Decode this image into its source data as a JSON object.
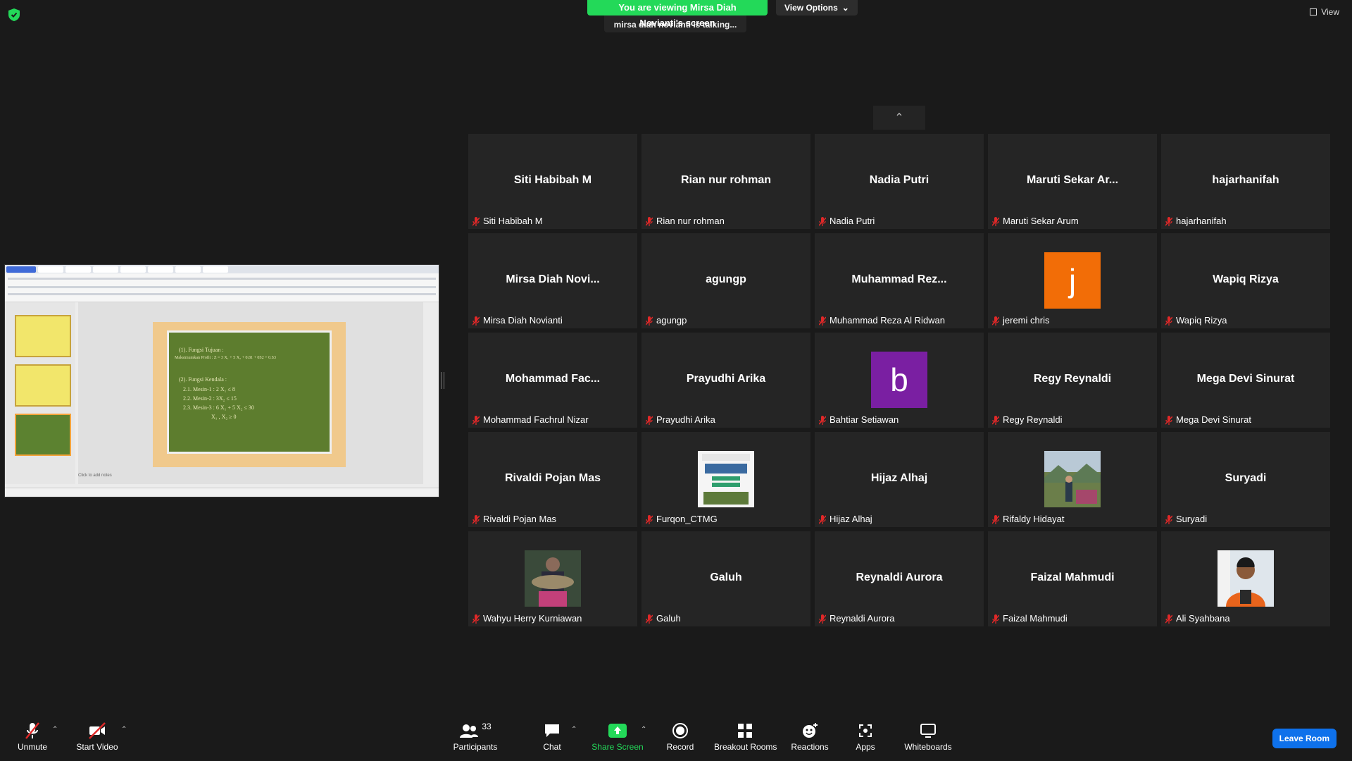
{
  "banner": {
    "viewing": "You are viewing Mirsa Diah Novianti's screen",
    "view_options": "View Options"
  },
  "talking": "mirsa diah novianti is talking...",
  "view_label": "View",
  "shared_slide": {
    "lines": [
      "(1). Fungsi Tujuan :",
      "Maksimumkan Profit : Z = 3 X₁ + 5 X₂ + 0.81 + 0S2 + 0.S3",
      "(2). Fungsi Kendala :",
      "2.1. Mesin-1 :  2 X₁      ≤ 8",
      "2.2. Mesin-2 :      3X₂     ≤ 15",
      "2.3. Mesin-3 :  6 X₁ + 5 X₂ ≤ 30",
      "X₁ , X₂ ≥ 0"
    ],
    "notes": "Click to add notes"
  },
  "tiles": [
    {
      "big": "Siti Habibah M",
      "name": "Siti Habibah M"
    },
    {
      "big": "Rian nur rohman",
      "name": "Rian nur rohman"
    },
    {
      "big": "Nadia Putri",
      "name": "Nadia Putri"
    },
    {
      "big": "Maruti Sekar Ar...",
      "name": "Maruti Sekar Arum"
    },
    {
      "big": "hajarhanifah",
      "name": "hajarhanifah"
    },
    {
      "big": "Mirsa Diah Novi...",
      "name": "Mirsa Diah Novianti"
    },
    {
      "big": "agungp",
      "name": "agungp"
    },
    {
      "big": "Muhammad Rez...",
      "name": "Muhammad Reza Al Ridwan"
    },
    {
      "big": "j",
      "name": "jeremi chris",
      "avatar": "#f26d07"
    },
    {
      "big": "Wapiq Rizya",
      "name": "Wapiq Rizya"
    },
    {
      "big": "Mohammad Fac...",
      "name": "Mohammad Fachrul Nizar"
    },
    {
      "big": "Prayudhi Arika",
      "name": "Prayudhi Arika"
    },
    {
      "big": "b",
      "name": "Bahtiar Setiawan",
      "avatar": "#7a1fa2"
    },
    {
      "big": "Regy Reynaldi",
      "name": "Regy Reynaldi"
    },
    {
      "big": "Mega Devi Sinurat",
      "name": "Mega Devi Sinurat"
    },
    {
      "big": "Rivaldi Pojan Mas",
      "name": "Rivaldi Pojan Mas"
    },
    {
      "big": "",
      "name": "Furqon_CTMG",
      "photo": "poster"
    },
    {
      "big": "Hijaz Alhaj",
      "name": "Hijaz Alhaj"
    },
    {
      "big": "",
      "name": "Rifaldy Hidayat",
      "photo": "landscape"
    },
    {
      "big": "Suryadi",
      "name": "Suryadi"
    },
    {
      "big": "",
      "name": "Wahyu Herry Kurniawan",
      "photo": "fish"
    },
    {
      "big": "Galuh",
      "name": "Galuh"
    },
    {
      "big": "Reynaldi Aurora",
      "name": "Reynaldi Aurora"
    },
    {
      "big": "Faizal Mahmudi",
      "name": "Faizal Mahmudi"
    },
    {
      "big": "",
      "name": "Ali Syahbana",
      "photo": "person"
    }
  ],
  "toolbar": {
    "unmute": "Unmute",
    "start_video": "Start Video",
    "participants": "Participants",
    "participants_count": "33",
    "chat": "Chat",
    "share_screen": "Share Screen",
    "record": "Record",
    "breakout_rooms": "Breakout Rooms",
    "reactions": "Reactions",
    "apps": "Apps",
    "whiteboards": "Whiteboards",
    "leave": "Leave Room"
  },
  "colors": {
    "share_green": "#23d959",
    "leave_blue": "#0e71eb",
    "mute_red": "#e02828"
  }
}
